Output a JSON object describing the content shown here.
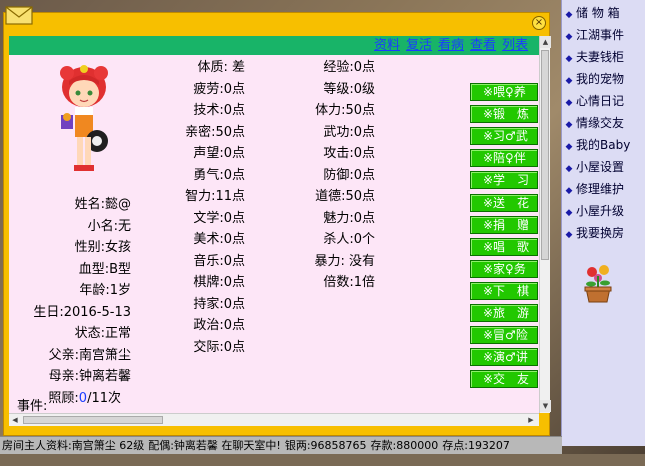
{
  "sidebar": {
    "items": [
      {
        "label": "储 物 箱"
      },
      {
        "label": "江湖事件"
      },
      {
        "label": "夫妻钱柜"
      },
      {
        "label": "我的宠物"
      },
      {
        "label": "心情日记"
      },
      {
        "label": "情缘交友"
      },
      {
        "label": "我的Baby"
      },
      {
        "label": "小屋设置"
      },
      {
        "label": "修理维护"
      },
      {
        "label": "小屋升级"
      },
      {
        "label": "我要换房"
      }
    ]
  },
  "nav": {
    "links": [
      "资料",
      "复活",
      "看病",
      "查看",
      "列表"
    ]
  },
  "close_label": "×",
  "profile": {
    "name": "姓名:懿@",
    "nickname": "小名:无",
    "gender": "性别:女孩",
    "blood": "血型:B型",
    "age": "年龄:1岁",
    "birthday": "生日:2016-5-13",
    "state": "状态:正常",
    "father": "父亲:南宫箫尘",
    "mother": "母亲:钟离若馨",
    "care_prefix": "照顾:",
    "care_value": "0",
    "care_suffix": "/11次",
    "event_label": "事件:"
  },
  "stats_col2": [
    "体质: 差",
    "疲劳:0点",
    "技术:0点",
    "亲密:50点",
    "声望:0点",
    "勇气:0点",
    "智力:11点",
    "文学:0点",
    "美术:0点",
    "音乐:0点",
    "棋牌:0点",
    "持家:0点",
    "政治:0点",
    "交际:0点"
  ],
  "stats_col3": [
    "经验:0点",
    "等级:0级",
    "体力:50点",
    "武功:0点",
    "攻击:0点",
    "防御:0点",
    "道德:50点",
    "魅力:0点",
    "杀人:0个",
    "暴力: 没有",
    "倍数:1倍"
  ],
  "actions": [
    "※喂♀养",
    "※锻　炼",
    "※习♂武",
    "※陪♀伴",
    "※学　习",
    "※送　花",
    "※捐　赠",
    "※唱　歌",
    "※家♀务",
    "※下　棋",
    "※旅　游",
    "※冒♂险",
    "※演♂讲",
    "※交　友"
  ],
  "statusbar": {
    "owner": "房间主人资料:南宫箫尘 62级",
    "spouse": "配偶:钟离若馨 在聊天室中!",
    "silver": "银两:96858765",
    "deposit": "存款:880000",
    "points": "存点:193207"
  },
  "colors": {
    "dialog_frame": "#f7bf00",
    "title_bar": "#18b468",
    "content_bg": "#fde6f7",
    "action_button": "#22c800",
    "link": "#1a3cff",
    "sidebar_bg": "#dcdcf4"
  }
}
